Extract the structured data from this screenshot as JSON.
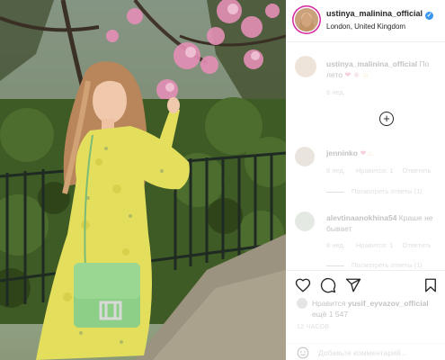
{
  "post": {
    "username": "ustinya_malinina_official",
    "location": "London, United Kingdom",
    "verified_mark": "✓"
  },
  "caption": {
    "username": "ustinya_malinina_official",
    "text": "По",
    "text2": "лето",
    "time": "8 нед."
  },
  "load_more_icon": "plus-circle-icon",
  "comments": [
    {
      "username": "jenninko",
      "text": "",
      "time": "8 нед.",
      "likes": "Нравится: 1",
      "reply": "Ответить",
      "view_replies": "Посмотреть ответы (1)"
    },
    {
      "username": "alevtinaanokhina54",
      "text": "Краше не",
      "text2": "бывает",
      "time": "8 нед.",
      "likes": "Нравится: 1",
      "reply": "Ответить",
      "view_replies": "Посмотреть ответы (1)"
    }
  ],
  "actions": {
    "like_icon": "heart-icon",
    "comment_icon": "comment-icon",
    "share_icon": "share-icon",
    "save_icon": "bookmark-icon"
  },
  "liked_by": {
    "prefix": "Нравится",
    "user": "yusif_eyvazov_official",
    "line2": "ещё 1 547"
  },
  "time_ago": "12 ЧАСОВ",
  "add_comment": {
    "placeholder": "Добавьте комментарий...",
    "emoji_icon": "smile-icon"
  },
  "colors": {
    "verified": "#3897f0",
    "dress": "#e3df5c",
    "bag": "#8dcf87",
    "blossom": "#e58fb6",
    "story_ring": "#d6249f"
  }
}
